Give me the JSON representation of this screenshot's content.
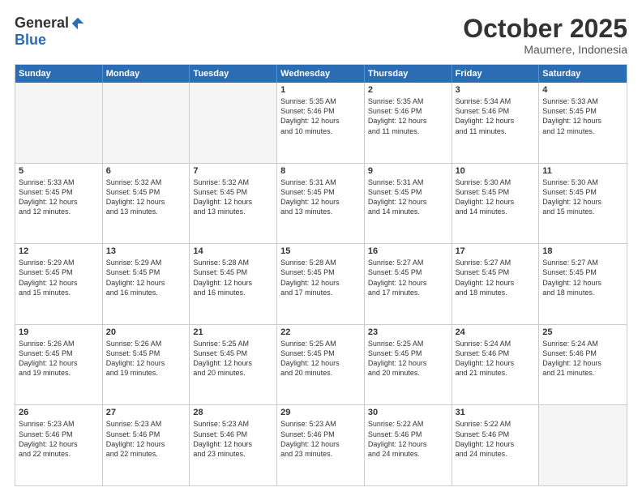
{
  "logo": {
    "general": "General",
    "blue": "Blue"
  },
  "title": "October 2025",
  "location": "Maumere, Indonesia",
  "days": [
    "Sunday",
    "Monday",
    "Tuesday",
    "Wednesday",
    "Thursday",
    "Friday",
    "Saturday"
  ],
  "rows": [
    [
      {
        "day": "",
        "empty": true
      },
      {
        "day": "",
        "empty": true
      },
      {
        "day": "",
        "empty": true
      },
      {
        "day": "1",
        "lines": [
          "Sunrise: 5:35 AM",
          "Sunset: 5:46 PM",
          "Daylight: 12 hours",
          "and 10 minutes."
        ]
      },
      {
        "day": "2",
        "lines": [
          "Sunrise: 5:35 AM",
          "Sunset: 5:46 PM",
          "Daylight: 12 hours",
          "and 11 minutes."
        ]
      },
      {
        "day": "3",
        "lines": [
          "Sunrise: 5:34 AM",
          "Sunset: 5:46 PM",
          "Daylight: 12 hours",
          "and 11 minutes."
        ]
      },
      {
        "day": "4",
        "lines": [
          "Sunrise: 5:33 AM",
          "Sunset: 5:45 PM",
          "Daylight: 12 hours",
          "and 12 minutes."
        ]
      }
    ],
    [
      {
        "day": "5",
        "lines": [
          "Sunrise: 5:33 AM",
          "Sunset: 5:45 PM",
          "Daylight: 12 hours",
          "and 12 minutes."
        ]
      },
      {
        "day": "6",
        "lines": [
          "Sunrise: 5:32 AM",
          "Sunset: 5:45 PM",
          "Daylight: 12 hours",
          "and 13 minutes."
        ]
      },
      {
        "day": "7",
        "lines": [
          "Sunrise: 5:32 AM",
          "Sunset: 5:45 PM",
          "Daylight: 12 hours",
          "and 13 minutes."
        ]
      },
      {
        "day": "8",
        "lines": [
          "Sunrise: 5:31 AM",
          "Sunset: 5:45 PM",
          "Daylight: 12 hours",
          "and 13 minutes."
        ]
      },
      {
        "day": "9",
        "lines": [
          "Sunrise: 5:31 AM",
          "Sunset: 5:45 PM",
          "Daylight: 12 hours",
          "and 14 minutes."
        ]
      },
      {
        "day": "10",
        "lines": [
          "Sunrise: 5:30 AM",
          "Sunset: 5:45 PM",
          "Daylight: 12 hours",
          "and 14 minutes."
        ]
      },
      {
        "day": "11",
        "lines": [
          "Sunrise: 5:30 AM",
          "Sunset: 5:45 PM",
          "Daylight: 12 hours",
          "and 15 minutes."
        ]
      }
    ],
    [
      {
        "day": "12",
        "lines": [
          "Sunrise: 5:29 AM",
          "Sunset: 5:45 PM",
          "Daylight: 12 hours",
          "and 15 minutes."
        ]
      },
      {
        "day": "13",
        "lines": [
          "Sunrise: 5:29 AM",
          "Sunset: 5:45 PM",
          "Daylight: 12 hours",
          "and 16 minutes."
        ]
      },
      {
        "day": "14",
        "lines": [
          "Sunrise: 5:28 AM",
          "Sunset: 5:45 PM",
          "Daylight: 12 hours",
          "and 16 minutes."
        ]
      },
      {
        "day": "15",
        "lines": [
          "Sunrise: 5:28 AM",
          "Sunset: 5:45 PM",
          "Daylight: 12 hours",
          "and 17 minutes."
        ]
      },
      {
        "day": "16",
        "lines": [
          "Sunrise: 5:27 AM",
          "Sunset: 5:45 PM",
          "Daylight: 12 hours",
          "and 17 minutes."
        ]
      },
      {
        "day": "17",
        "lines": [
          "Sunrise: 5:27 AM",
          "Sunset: 5:45 PM",
          "Daylight: 12 hours",
          "and 18 minutes."
        ]
      },
      {
        "day": "18",
        "lines": [
          "Sunrise: 5:27 AM",
          "Sunset: 5:45 PM",
          "Daylight: 12 hours",
          "and 18 minutes."
        ]
      }
    ],
    [
      {
        "day": "19",
        "lines": [
          "Sunrise: 5:26 AM",
          "Sunset: 5:45 PM",
          "Daylight: 12 hours",
          "and 19 minutes."
        ]
      },
      {
        "day": "20",
        "lines": [
          "Sunrise: 5:26 AM",
          "Sunset: 5:45 PM",
          "Daylight: 12 hours",
          "and 19 minutes."
        ]
      },
      {
        "day": "21",
        "lines": [
          "Sunrise: 5:25 AM",
          "Sunset: 5:45 PM",
          "Daylight: 12 hours",
          "and 20 minutes."
        ]
      },
      {
        "day": "22",
        "lines": [
          "Sunrise: 5:25 AM",
          "Sunset: 5:45 PM",
          "Daylight: 12 hours",
          "and 20 minutes."
        ]
      },
      {
        "day": "23",
        "lines": [
          "Sunrise: 5:25 AM",
          "Sunset: 5:45 PM",
          "Daylight: 12 hours",
          "and 20 minutes."
        ]
      },
      {
        "day": "24",
        "lines": [
          "Sunrise: 5:24 AM",
          "Sunset: 5:46 PM",
          "Daylight: 12 hours",
          "and 21 minutes."
        ]
      },
      {
        "day": "25",
        "lines": [
          "Sunrise: 5:24 AM",
          "Sunset: 5:46 PM",
          "Daylight: 12 hours",
          "and 21 minutes."
        ]
      }
    ],
    [
      {
        "day": "26",
        "lines": [
          "Sunrise: 5:23 AM",
          "Sunset: 5:46 PM",
          "Daylight: 12 hours",
          "and 22 minutes."
        ]
      },
      {
        "day": "27",
        "lines": [
          "Sunrise: 5:23 AM",
          "Sunset: 5:46 PM",
          "Daylight: 12 hours",
          "and 22 minutes."
        ]
      },
      {
        "day": "28",
        "lines": [
          "Sunrise: 5:23 AM",
          "Sunset: 5:46 PM",
          "Daylight: 12 hours",
          "and 23 minutes."
        ]
      },
      {
        "day": "29",
        "lines": [
          "Sunrise: 5:23 AM",
          "Sunset: 5:46 PM",
          "Daylight: 12 hours",
          "and 23 minutes."
        ]
      },
      {
        "day": "30",
        "lines": [
          "Sunrise: 5:22 AM",
          "Sunset: 5:46 PM",
          "Daylight: 12 hours",
          "and 24 minutes."
        ]
      },
      {
        "day": "31",
        "lines": [
          "Sunrise: 5:22 AM",
          "Sunset: 5:46 PM",
          "Daylight: 12 hours",
          "and 24 minutes."
        ]
      },
      {
        "day": "",
        "empty": true
      }
    ]
  ]
}
